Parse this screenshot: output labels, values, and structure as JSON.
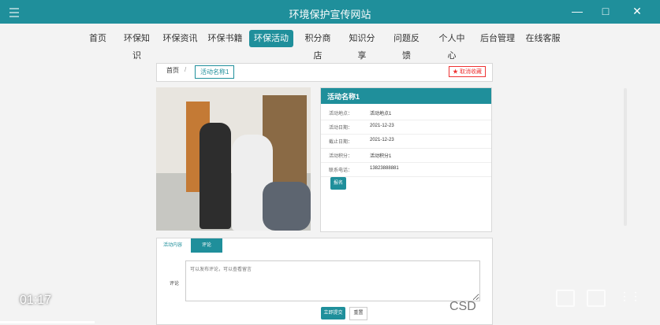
{
  "window": {
    "title": "环境保护宣传网站"
  },
  "nav": [
    "首页",
    "环保知识",
    "环保资讯",
    "环保书籍",
    "环保活动",
    "积分商店",
    "知识分享",
    "问题反馈",
    "个人中心",
    "后台管理",
    "在线客服"
  ],
  "breadcrumb": {
    "home": "首页",
    "sep": "/",
    "current": "活动名称1",
    "favorite": "★ 取消收藏"
  },
  "activity": {
    "title": "活动名称1",
    "fields": [
      {
        "label": "活动地点：",
        "value": "活动地点1"
      },
      {
        "label": "活动日期：",
        "value": "2021-12-23"
      },
      {
        "label": "截止日期：",
        "value": "2021-12-23"
      },
      {
        "label": "活动积分：",
        "value": "活动积分1"
      },
      {
        "label": "联系电话：",
        "value": "13823888881"
      }
    ],
    "register_button": "报名"
  },
  "tabs": [
    "活动内容",
    "评论"
  ],
  "comment": {
    "label": "评论",
    "placeholder": "可以发布评论，可以查看留言",
    "submit": "立即提交",
    "reset": "重置"
  },
  "overlay": {
    "time": "01:17",
    "brand": "CSD"
  }
}
